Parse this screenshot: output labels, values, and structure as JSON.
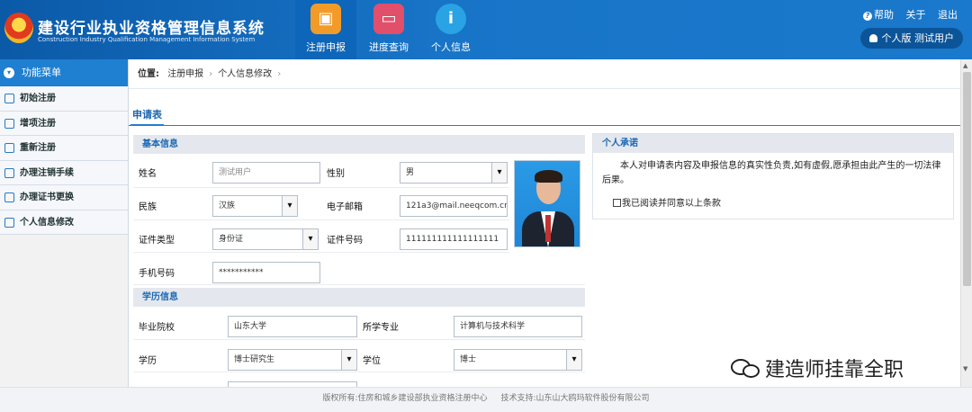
{
  "header": {
    "title": "建设行业执业资格管理信息系统",
    "subtitle": "Construction Industry Qualification Management Information System",
    "nav": [
      {
        "label": "注册申报",
        "icon": "register-icon",
        "active": true
      },
      {
        "label": "进度查询",
        "icon": "progress-monitor-icon",
        "active": false
      },
      {
        "label": "个人信息",
        "icon": "info-icon",
        "active": false
      }
    ],
    "links": {
      "help": "帮助",
      "about": "关于",
      "logout": "退出"
    },
    "user": {
      "edition": "个人版",
      "name": "测试用户"
    }
  },
  "sidebar": {
    "title": "功能菜单",
    "items": [
      {
        "label": "初始注册"
      },
      {
        "label": "增项注册"
      },
      {
        "label": "重新注册"
      },
      {
        "label": "办理注销手续"
      },
      {
        "label": "办理证书更换"
      },
      {
        "label": "个人信息修改"
      }
    ]
  },
  "breadcrumb": {
    "prefix": "位置:",
    "items": [
      "注册申报",
      "个人信息修改"
    ],
    "sep": "›"
  },
  "form": {
    "tab": "申请表",
    "basic": {
      "heading": "基本信息",
      "name_label": "姓名",
      "name_placeholder": "测试用户",
      "gender_label": "性别",
      "gender_value": "男",
      "ethnicity_label": "民族",
      "ethnicity_value": "汉族",
      "email_label": "电子邮箱",
      "email_value": "121a3@mail.neeqcom.cn",
      "idtype_label": "证件类型",
      "idtype_value": "身份证",
      "idno_label": "证件号码",
      "idno_value": "111111111111111111",
      "phone_label": "手机号码",
      "phone_value": "***********"
    },
    "education": {
      "heading": "学历信息",
      "school_label": "毕业院校",
      "school_value": "山东大学",
      "major_label": "所学专业",
      "major_value": "计算机与技术科学",
      "degree_level_label": "学历",
      "degree_level_value": "博士研究生",
      "degree_label": "学位",
      "degree_value": "博士"
    }
  },
  "pledge": {
    "heading": "个人承诺",
    "text": "本人对申请表内容及申报信息的真实性负责,如有虚假,愿承担由此产生的一切法律后果。",
    "agree_label": "我已阅读并同意以上条款",
    "agree_checked": false
  },
  "footer": {
    "copyright": "版权所有:住房和城乡建设部执业资格注册中心",
    "support": "技术支持:山东山大鸥玛软件股份有限公司"
  },
  "watermark": "建造师挂靠全职"
}
